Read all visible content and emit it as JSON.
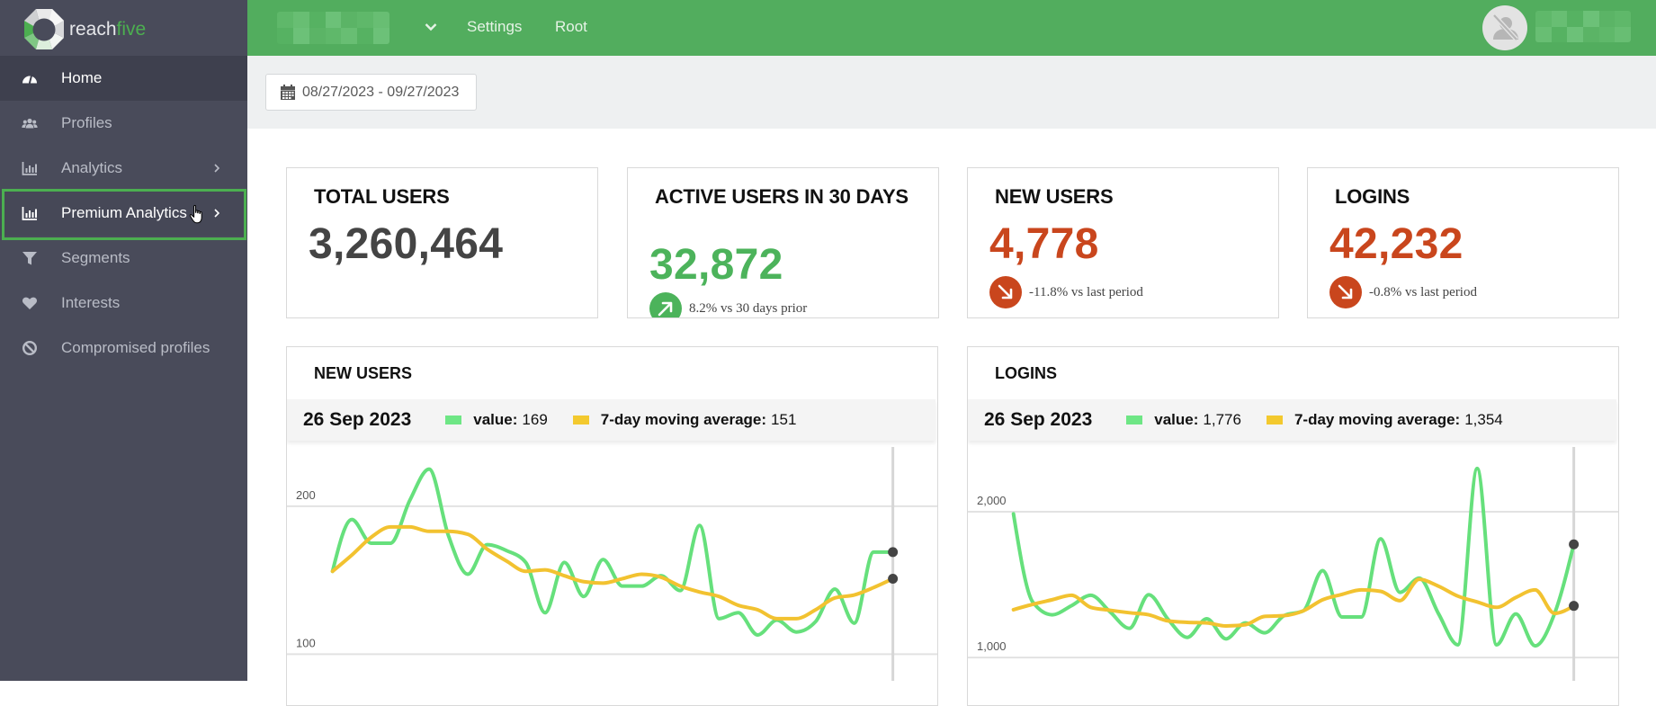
{
  "brand": {
    "name_part1": "reach",
    "name_part2": "five"
  },
  "sidebar": {
    "items": [
      {
        "label": "Home",
        "icon": "dashboard-icon",
        "active": true
      },
      {
        "label": "Profiles",
        "icon": "users-icon"
      },
      {
        "label": "Analytics",
        "icon": "bar-chart-icon",
        "has_submenu": true
      },
      {
        "label": "Premium Analytics",
        "icon": "bar-chart-icon",
        "has_submenu": true,
        "highlighted": true
      },
      {
        "label": "Segments",
        "icon": "filter-icon"
      },
      {
        "label": "Interests",
        "icon": "heart-icon"
      },
      {
        "label": "Compromised profiles",
        "icon": "ban-icon"
      }
    ]
  },
  "topbar": {
    "org_selector_icon": "chevron-down-icon",
    "links": {
      "settings": "Settings",
      "root": "Root"
    },
    "avatar_icon": "user-slash-icon"
  },
  "filters": {
    "date_range": "08/27/2023 - 09/27/2023",
    "icon": "calendar-icon"
  },
  "kpis": [
    {
      "title": "TOTAL USERS",
      "value": "3,260,464"
    },
    {
      "title": "ACTIVE USERS IN 30 DAYS",
      "value": "32,872",
      "trend": "up",
      "change": "8.2% vs 30 days prior"
    },
    {
      "title": "NEW USERS",
      "value": "4,778",
      "trend": "down",
      "change": "-11.8% vs last period"
    },
    {
      "title": "LOGINS",
      "value": "42,232",
      "trend": "down",
      "change": "-0.8% vs last period"
    }
  ],
  "colors": {
    "brand_green": "#52ad5e",
    "positive": "#4cb35b",
    "negative": "#c9461d",
    "value_series": "#66e07c",
    "average_series": "#f2c230"
  },
  "chart_data": [
    {
      "type": "line",
      "title": "NEW USERS",
      "tooltip": {
        "date": "26 Sep 2023",
        "value_label": "value:",
        "value": "169",
        "avg_label": "7-day moving average:",
        "avg": "151"
      },
      "series": [
        {
          "name": "value",
          "color": "#66e07c",
          "values": [
            156,
            191,
            175,
            175,
            204,
            225,
            180,
            154,
            174,
            170,
            162,
            128,
            162,
            139,
            164,
            146,
            146,
            153,
            143,
            187,
            124,
            128,
            113,
            123,
            115,
            122,
            144,
            121,
            169,
            169
          ]
        },
        {
          "name": "7-day moving average",
          "color": "#f2c230",
          "values": [
            156,
            167,
            179,
            186,
            186,
            183,
            183,
            181,
            171,
            163,
            156,
            157,
            153,
            149,
            148,
            151,
            154,
            152,
            146,
            142,
            139,
            133,
            130,
            124,
            124,
            130,
            138,
            140,
            145,
            151
          ]
        }
      ],
      "yticks": [
        {
          "value": 100,
          "label": "100"
        },
        {
          "value": 200,
          "label": "200"
        }
      ],
      "ylim": [
        82,
        240
      ],
      "grid": true,
      "highlight_index": 29,
      "xlabel": "",
      "ylabel": ""
    },
    {
      "type": "line",
      "title": "LOGINS",
      "tooltip": {
        "date": "26 Sep 2023",
        "value_label": "value:",
        "value": "1,776",
        "avg_label": "7-day moving average:",
        "avg": "1,354"
      },
      "series": [
        {
          "name": "value",
          "color": "#66e07c",
          "values": [
            1985,
            1380,
            1293,
            1355,
            1427,
            1313,
            1200,
            1431,
            1262,
            1138,
            1266,
            1128,
            1237,
            1169,
            1287,
            1320,
            1596,
            1278,
            1278,
            1814,
            1447,
            1544,
            1300,
            1087,
            2297,
            1087,
            1299,
            1080,
            1300,
            1776
          ]
        },
        {
          "name": "7-day moving average",
          "color": "#f2c230",
          "values": [
            1328,
            1365,
            1396,
            1427,
            1344,
            1324,
            1307,
            1293,
            1251,
            1241,
            1237,
            1216,
            1225,
            1282,
            1287,
            1320,
            1396,
            1433,
            1464,
            1454,
            1390,
            1536,
            1489,
            1421,
            1381,
            1344,
            1412,
            1464,
            1303,
            1354
          ]
        }
      ],
      "yticks": [
        {
          "value": 1000,
          "label": "1,000"
        },
        {
          "value": 2000,
          "label": "2,000"
        }
      ],
      "ylim": [
        840,
        2444
      ],
      "grid": true,
      "highlight_index": 29,
      "xlabel": "",
      "ylabel": ""
    }
  ]
}
